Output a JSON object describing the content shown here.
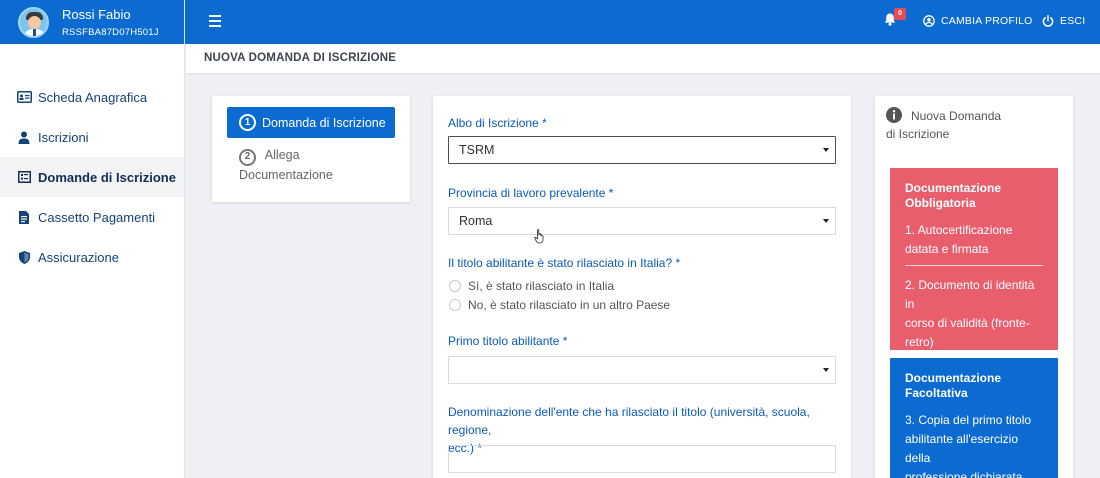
{
  "user": {
    "name": "Rossi Fabio",
    "code": "RSSFBA87D07H501J"
  },
  "topbar": {
    "notifications_count": "0",
    "change_profile_label": "CAMBIA PROFILO",
    "logout_label": "ESCI"
  },
  "sidebar": {
    "items": [
      {
        "label": "Scheda Anagrafica",
        "icon": "id-card-icon"
      },
      {
        "label": "Iscrizioni",
        "icon": "user-icon"
      },
      {
        "label": "Domande di Iscrizione",
        "icon": "form-icon",
        "active": true
      },
      {
        "label": "Cassetto Pagamenti",
        "icon": "document-icon"
      },
      {
        "label": "Assicurazione",
        "icon": "shield-icon"
      }
    ]
  },
  "page": {
    "title": "NUOVA DOMANDA DI ISCRIZIONE"
  },
  "steps": [
    {
      "number": "1",
      "label": "Domanda di Iscrizione",
      "active": true
    },
    {
      "number": "2",
      "label_line1": "Allega",
      "label_line2": "Documentazione",
      "active": false
    }
  ],
  "form": {
    "albo": {
      "label": "Albo di Iscrizione *",
      "value": "TSRM"
    },
    "provincia": {
      "label": "Provincia di lavoro prevalente *",
      "value": "Roma"
    },
    "titolo_italia": {
      "label": "Il titolo abilitante è stato rilasciato in Italia? *",
      "options": [
        "Sì, è stato rilasciato in Italia",
        "No, è stato rilasciato in un altro Paese"
      ]
    },
    "primo_titolo": {
      "label": "Primo titolo abilitante *",
      "value": ""
    },
    "ente": {
      "label_line1": "Denominazione dell'ente che ha rilasciato il titolo (università, scuola, regione,",
      "label_line2": "ecc.) *",
      "value": ""
    }
  },
  "info": {
    "title_line1": "Nuova Domanda",
    "title_line2": "di Iscrizione",
    "obbligatoria": {
      "title_line1": "Documentazione",
      "title_line2": "Obbligatoria",
      "items": [
        {
          "l1": "1. Autocertificazione",
          "l2": "datata e firmata"
        },
        {
          "l1": "2. Documento di identità in",
          "l2": "corso di validità (fronte-",
          "l3": "retro)"
        }
      ]
    },
    "facoltativa": {
      "title_line1": "Documentazione",
      "title_line2": "Facoltativa",
      "items": [
        {
          "l1": "3. Copia del primo titolo",
          "l2": "abilitante all'esercizio della",
          "l3": "professione dichiarata"
        }
      ]
    }
  },
  "colors": {
    "primary": "#0c6bd0",
    "danger": "#e85e6d",
    "label": "#0a5bb5",
    "badge": "#e84a57"
  }
}
